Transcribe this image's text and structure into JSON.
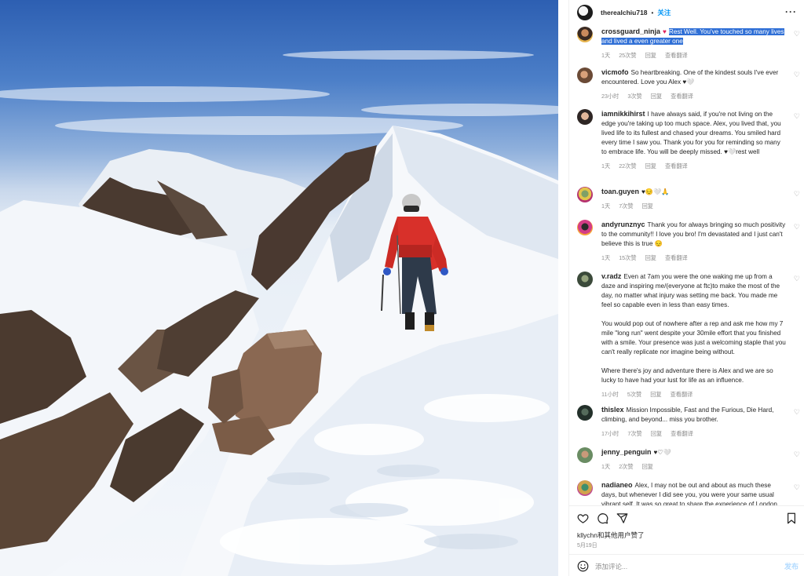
{
  "post": {
    "username": "therealchiu718",
    "separator": "•",
    "follow_label": "关注",
    "more_label": "···"
  },
  "comments": [
    {
      "user": "crossguard_ninja",
      "text": "Rest Well. You've touched so many lives and lived a even greater one",
      "time": "1天",
      "likes": "25次赞",
      "reply": "回复",
      "translate": "查看翻译",
      "emoji_prefix": "♥"
    },
    {
      "user": "vicmofo",
      "text": "So heartbreaking. One of the kindest souls I've ever encountered. Love you Alex ♥🤍",
      "time": "23小时",
      "likes": "3次赞",
      "reply": "回复",
      "translate": "查看翻译"
    },
    {
      "user": "iamnikkihirst",
      "text": "I have always said, if you're not living on the edge you're taking up too much space. Alex, you lived that, you lived life to its fullest and chased your dreams. You smiled hard every time I saw you. Thank you for you for reminding so many to embrace life. You will be deeply missed. ♥🤍rest well",
      "time": "1天",
      "likes": "22次赞",
      "reply": "回复",
      "translate": "查看翻译"
    },
    {
      "user": "toan.guyen",
      "text": "♥😔🤍🙏",
      "time": "1天",
      "likes": "7次赞",
      "reply": "回复",
      "translate": ""
    },
    {
      "user": "andyrunznyc",
      "text": "Thank you for always bringing so much positivity to the community!! I love you bro! I'm devastated and I just can't believe this is true 😔",
      "time": "1天",
      "likes": "15次赞",
      "reply": "回复",
      "translate": "查看翻译"
    },
    {
      "user": "v.radz",
      "text": "Even at 7am you were the one waking me up from a daze and inspiring me/(everyone at ftc)to make the most of the day, no matter what injury was setting me back. You made me feel so capable even in less than easy times.\n\nYou would pop out of nowhere after a rep and ask me how my 7 mile \"long run\" went despite your 30mile effort that you finished with a smile. Your presence was just a welcoming staple that you can't really replicate nor imagine being without.\n\nWhere there's joy and adventure there is Alex and we are so lucky to have had your lust for life as an influence.",
      "time": "11小时",
      "likes": "5次赞",
      "reply": "回复",
      "translate": "查看翻译"
    },
    {
      "user": "thislex",
      "text": "Mission Impossible, Fast and the Furious, Die Hard, climbing, and beyond... miss you brother.",
      "time": "17小时",
      "likes": "7次赞",
      "reply": "回复",
      "translate": "查看翻译"
    },
    {
      "user": "jenny_penguin",
      "text": "♥♡🤍",
      "time": "1天",
      "likes": "2次赞",
      "reply": "回复",
      "translate": ""
    },
    {
      "user": "nadianeo",
      "text": "Alex, I may not be out and about as much these days, but whenever I did see you, you were your same usual vibrant self. It was so great to share the experience of London",
      "time": "",
      "likes": "",
      "reply": "",
      "translate": ""
    }
  ],
  "footer": {
    "likes_text": "kllychn和其他用户赞了",
    "date": "5月19日",
    "comment_placeholder": "添加评论...",
    "post_label": "发布"
  },
  "icons": {
    "like": "heart-icon",
    "comment": "comment-icon",
    "share": "share-icon",
    "save": "bookmark-icon",
    "emoji": "smile-icon"
  }
}
